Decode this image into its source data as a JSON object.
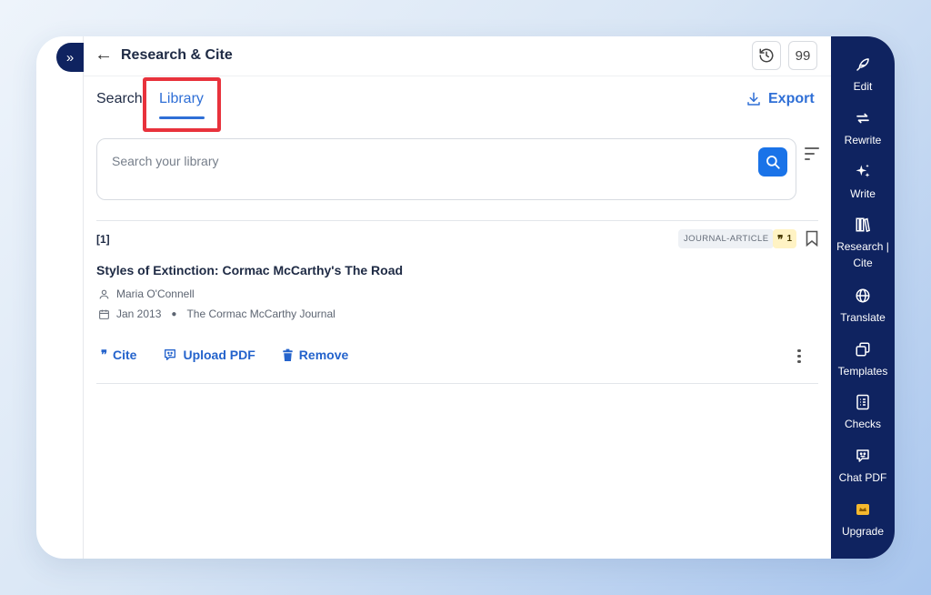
{
  "header": {
    "title": "Research & Cite",
    "quote_button": "99"
  },
  "tabs": [
    {
      "label": "Search",
      "active": false
    },
    {
      "label": "Library",
      "active": true
    }
  ],
  "export_label": "Export",
  "search": {
    "placeholder": "Search your library"
  },
  "result": {
    "ref_number": "[1]",
    "type_badge": "JOURNAL-ARTICLE",
    "citation_count": "1",
    "title": "Styles of Extinction: Cormac McCarthy's The Road",
    "author": "Maria O'Connell",
    "date": "Jan 2013",
    "journal": "The Cormac McCarthy Journal",
    "actions": {
      "cite": "Cite",
      "upload_pdf": "Upload PDF",
      "remove": "Remove"
    }
  },
  "sidebar": {
    "items": [
      {
        "label": "Edit",
        "icon": "feather-icon"
      },
      {
        "label": "Rewrite",
        "icon": "rewrite-icon"
      },
      {
        "label": "Write",
        "icon": "sparkles-icon"
      },
      {
        "label": "Research |",
        "label2": "Cite",
        "icon": "books-icon"
      },
      {
        "label": "Translate",
        "icon": "globe-icon"
      },
      {
        "label": "Templates",
        "icon": "templates-icon"
      },
      {
        "label": "Checks",
        "icon": "checklist-icon"
      },
      {
        "label": "Chat PDF",
        "icon": "chat-icon"
      },
      {
        "label": "Upgrade",
        "icon": "crown-icon"
      }
    ]
  },
  "colors": {
    "accent": "#2f6fd6",
    "sidebar_bg": "#0f2360",
    "highlight": "#e8323c"
  }
}
